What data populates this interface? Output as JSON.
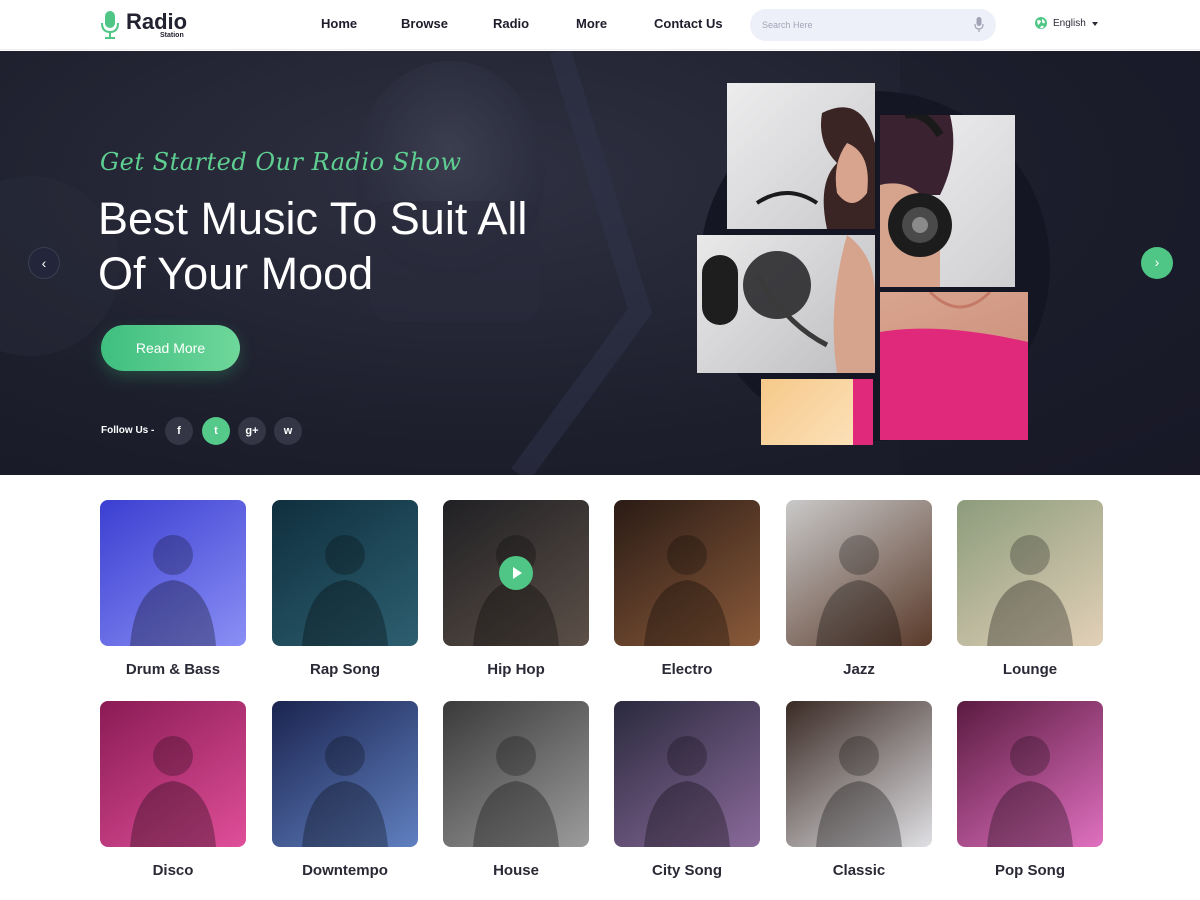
{
  "header": {
    "logo_title": "Radio",
    "logo_sub": "Station",
    "nav": [
      "Home",
      "Browse",
      "Radio",
      "More",
      "Contact Us"
    ],
    "search_placeholder": "Search Here",
    "language": "English"
  },
  "hero": {
    "subtitle": "Get Started Our Radio Show",
    "title_line1": "Best Music To Suit All",
    "title_line2": "Of Your Mood",
    "button": "Read More",
    "follow_label": "Follow Us -",
    "socials": [
      {
        "icon": "facebook-icon",
        "glyph": "f"
      },
      {
        "icon": "twitter-icon",
        "glyph": "t"
      },
      {
        "icon": "google-plus-icon",
        "glyph": "g+"
      },
      {
        "icon": "whatsapp-icon",
        "glyph": "w"
      }
    ],
    "prev_glyph": "‹",
    "next_glyph": "›"
  },
  "genres": [
    {
      "label": "Drum & Bass",
      "colors": [
        "#3b3fd1",
        "#8a8ff5"
      ]
    },
    {
      "label": "Rap Song",
      "colors": [
        "#0f2f3e",
        "#2d5f70"
      ]
    },
    {
      "label": "Hip Hop",
      "colors": [
        "#2b2b30",
        "#7b6b60"
      ]
    },
    {
      "label": "Electro",
      "colors": [
        "#2a1b15",
        "#8a5a3a"
      ]
    },
    {
      "label": "Jazz",
      "colors": [
        "#c9c9c9",
        "#5a3a2a"
      ]
    },
    {
      "label": "Lounge",
      "colors": [
        "#8c9c7c",
        "#e2d0b8"
      ]
    },
    {
      "label": "Disco",
      "colors": [
        "#8a1b54",
        "#e04f9a"
      ]
    },
    {
      "label": "Downtempo",
      "colors": [
        "#1b2450",
        "#6080c0"
      ]
    },
    {
      "label": "House",
      "colors": [
        "#3a3a3a",
        "#9c9c9c"
      ]
    },
    {
      "label": "City Song",
      "colors": [
        "#2a2a3e",
        "#8a6a9a"
      ]
    },
    {
      "label": "Classic",
      "colors": [
        "#3a2a24",
        "#e0e0e4"
      ]
    },
    {
      "label": "Pop Song",
      "colors": [
        "#5a1b40",
        "#e070c0"
      ]
    }
  ],
  "accent": "#4fc685"
}
